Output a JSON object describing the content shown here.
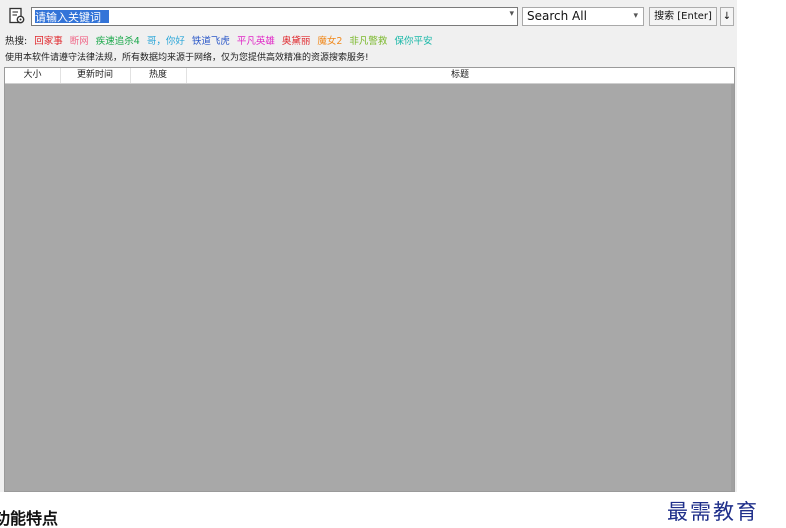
{
  "search": {
    "value": "请输入关键词",
    "scope_selected": "Search All",
    "button_label": "搜索 [Enter]",
    "sort_label": "↓"
  },
  "hot": {
    "label": "热搜:",
    "keywords": [
      {
        "text": "回家事",
        "color": "#e0282d"
      },
      {
        "text": "断网",
        "color": "#f06a8a"
      },
      {
        "text": "疾速追杀4",
        "color": "#1aa84a"
      },
      {
        "text": "哥，你好",
        "color": "#2aa6d8"
      },
      {
        "text": "铁道飞虎",
        "color": "#2b58c8"
      },
      {
        "text": "平凡英雄",
        "color": "#e026c6"
      },
      {
        "text": "奥黛丽",
        "color": "#e0282d"
      },
      {
        "text": "魔女2",
        "color": "#f08a1e"
      },
      {
        "text": "非凡警救",
        "color": "#7ab82a"
      },
      {
        "text": "保你平安",
        "color": "#1ab8a8"
      }
    ]
  },
  "notice": "使用本软件请遵守法律法规，所有数据均来源于网络，仅为您提供高效精准的资源搜索服务!",
  "table": {
    "columns": [
      "大小",
      "更新时间",
      "热度",
      "标题"
    ]
  },
  "watermark": "最需教育",
  "section_title": "功能特点",
  "colors": {
    "accent": "#3374d8",
    "results_bg": "#a8a8a8",
    "watermark": "#1f2f8a"
  }
}
